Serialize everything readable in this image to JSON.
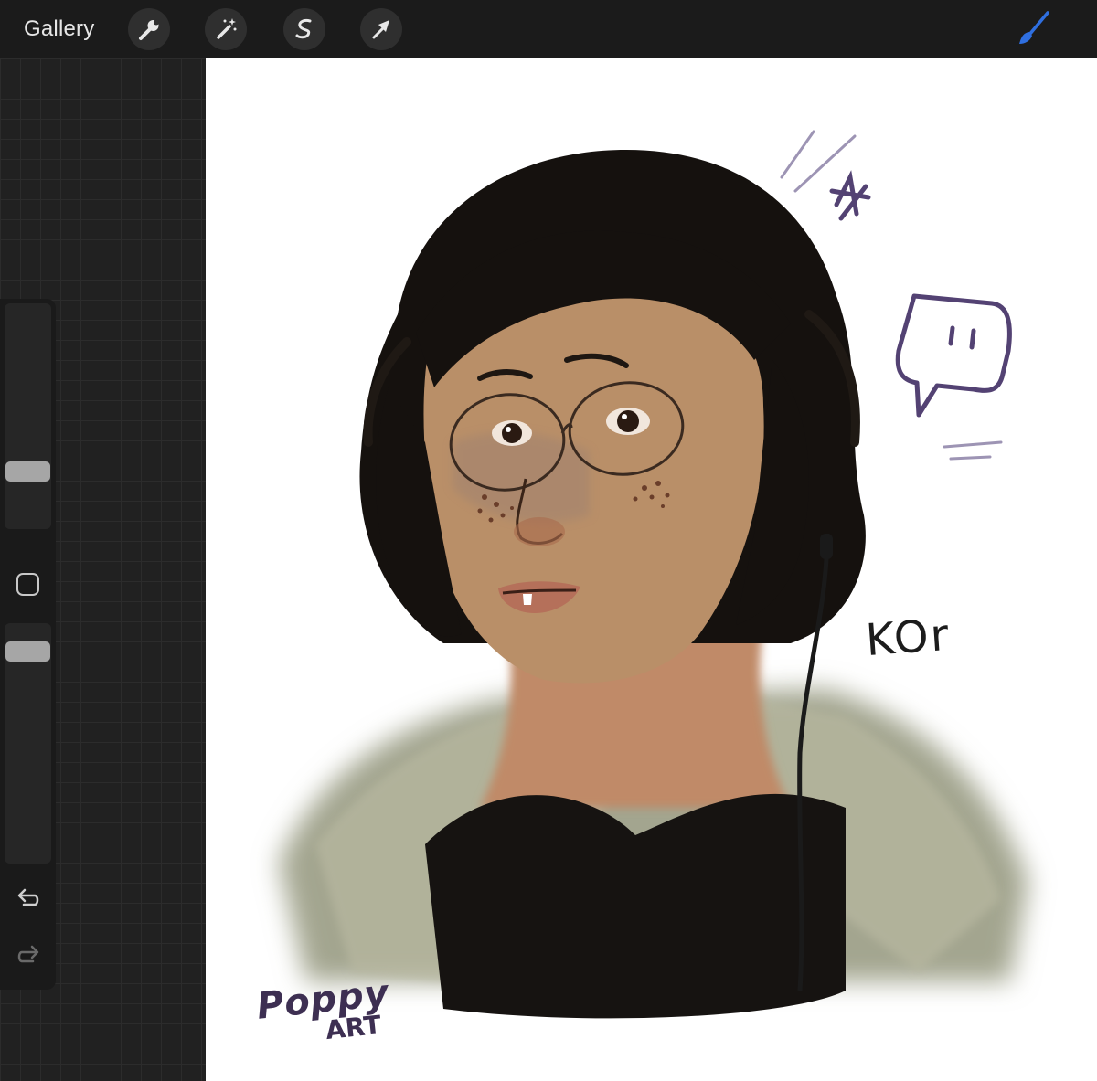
{
  "topbar": {
    "gallery_label": "Gallery",
    "tools": [
      {
        "icon": "wrench-icon"
      },
      {
        "icon": "magic-wand-icon"
      },
      {
        "icon": "selection-icon"
      },
      {
        "icon": "transform-arrow-icon"
      }
    ],
    "active_tool_icon": "brush-icon",
    "active_tool_color": "#2f6fe0"
  },
  "sidebar": {
    "brush_size_slider": {
      "icon": "slider-thumb"
    },
    "opacity_slider": {
      "icon": "slider-thumb"
    },
    "modifier_icon": "square-modifier-icon",
    "undo_icon": "undo-icon",
    "redo_icon": "redo-icon"
  },
  "canvas": {
    "background": "#ffffff",
    "signature_line1": "Poppy",
    "signature_line2": "ART",
    "doodle_text": "KOr"
  }
}
